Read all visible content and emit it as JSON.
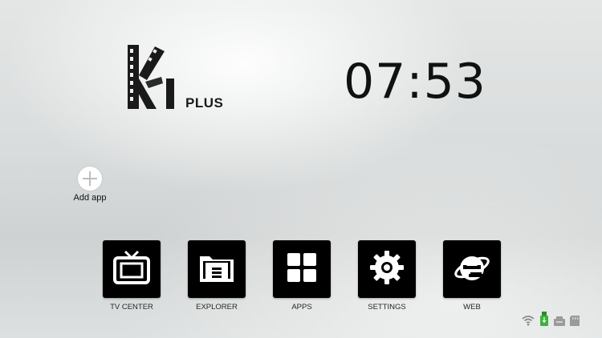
{
  "logo": {
    "letter_k": "K",
    "letter_i": "I",
    "suffix": "PLUS"
  },
  "clock": {
    "time": "07:53"
  },
  "add_app": {
    "label": "Add app"
  },
  "dock": {
    "apps": [
      {
        "label": "TV CENTER",
        "icon": "tv-icon"
      },
      {
        "label": "EXPLORER",
        "icon": "folder-icon"
      },
      {
        "label": "APPS",
        "icon": "apps-grid-icon"
      },
      {
        "label": "SETTINGS",
        "icon": "gear-icon"
      },
      {
        "label": "WEB",
        "icon": "browser-e-icon"
      }
    ]
  },
  "status_bar": {
    "icons": [
      "wifi-icon",
      "usb-storage-icon",
      "ethernet-icon",
      "sd-card-icon"
    ],
    "usb_color": "#3db23d"
  }
}
